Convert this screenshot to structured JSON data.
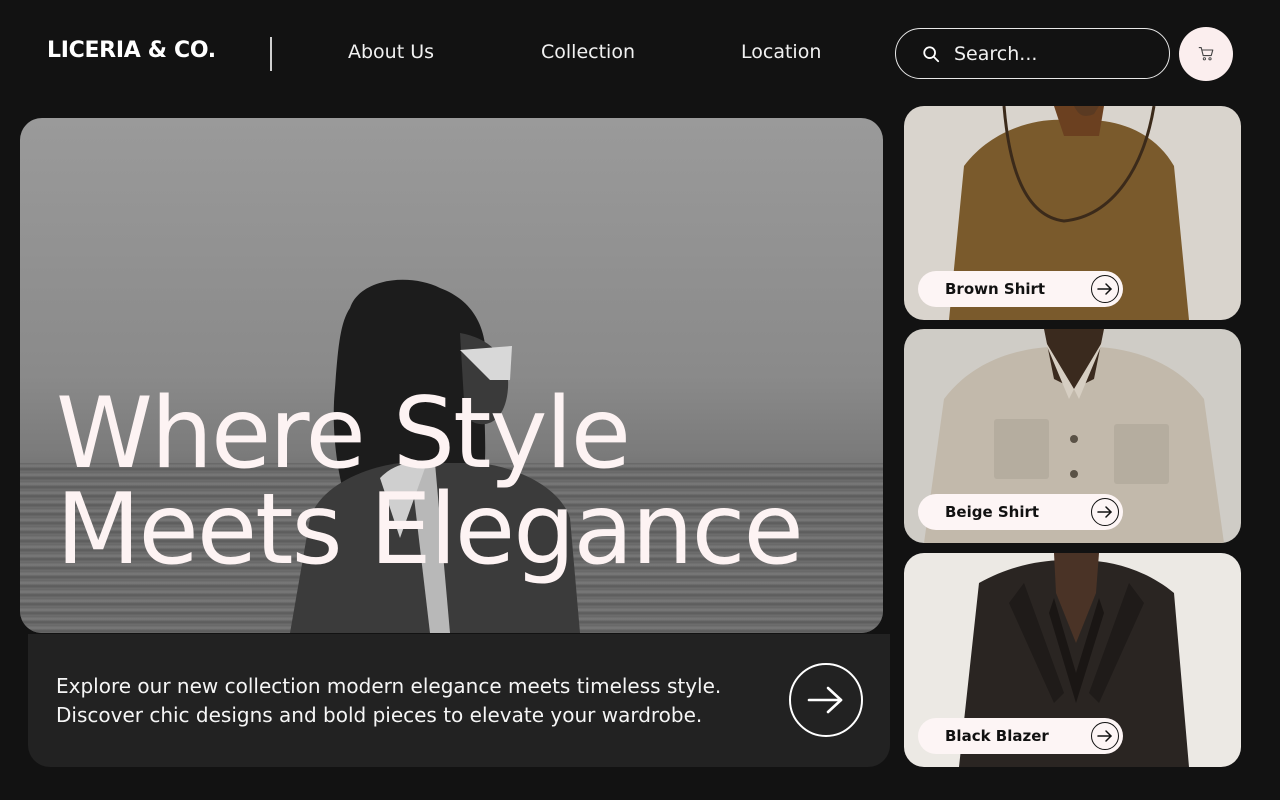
{
  "header": {
    "brand": "LICERIA & CO.",
    "nav": [
      "About Us",
      "Collection",
      "Location"
    ],
    "search_placeholder": "Search..."
  },
  "hero": {
    "title_line1": "Where Style",
    "title_line2": "Meets Elegance"
  },
  "description": {
    "line1": "Explore our new collection modern elegance meets timeless style.",
    "line2": "Discover chic designs and bold pieces to elevate your wardrobe."
  },
  "products": [
    {
      "name": "Brown Shirt"
    },
    {
      "name": "Beige Shirt"
    },
    {
      "name": "Black Blazer"
    }
  ],
  "colors": {
    "background": "#121212",
    "panel": "#222222",
    "accent_pink": "#fbeeee"
  }
}
